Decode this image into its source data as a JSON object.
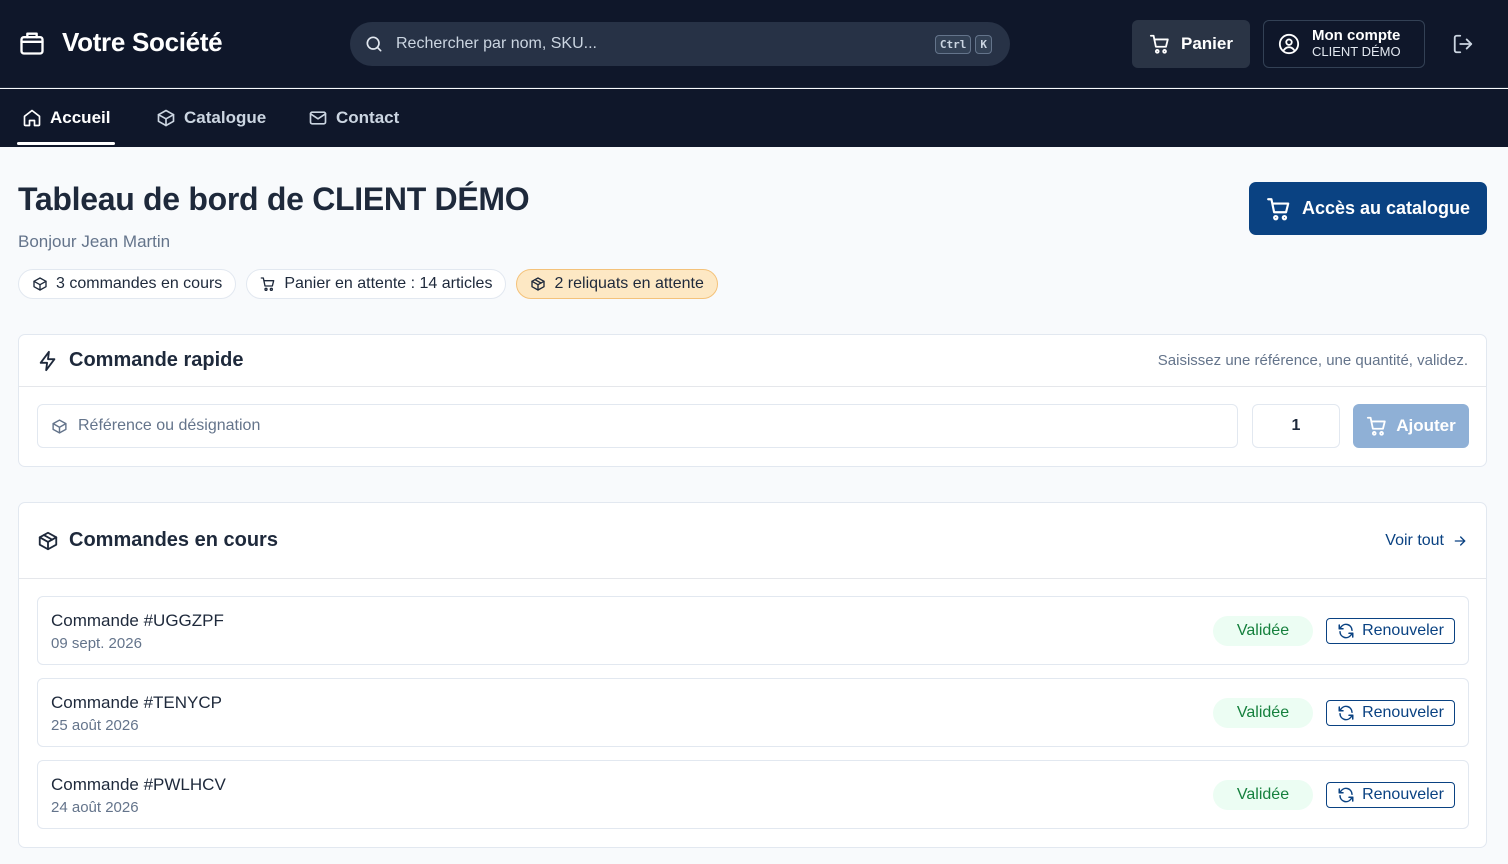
{
  "header": {
    "brand": "Votre Société",
    "search_placeholder": "Rechercher par nom, SKU...",
    "shortcut_keys": [
      "Ctrl",
      "K"
    ],
    "cart_label": "Panier",
    "account_title": "Mon compte",
    "account_subtitle": "CLIENT DÉMO"
  },
  "nav": {
    "items": [
      {
        "label": "Accueil",
        "icon": "home-icon",
        "active": true
      },
      {
        "label": "Catalogue",
        "icon": "package-icon",
        "active": false
      },
      {
        "label": "Contact",
        "icon": "mail-icon",
        "active": false
      }
    ]
  },
  "dashboard": {
    "title": "Tableau de bord de CLIENT DÉMO",
    "greeting": "Bonjour Jean Martin",
    "cta_label": "Accès au catalogue",
    "chips": [
      {
        "label": "3 commandes en cours",
        "icon": "package-icon"
      },
      {
        "label": "Panier en attente : 14 articles",
        "icon": "cart-icon"
      },
      {
        "label": "2 reliquats en attente",
        "icon": "boxes-icon"
      }
    ]
  },
  "quick_order": {
    "title": "Commande rapide",
    "hint": "Saisissez une référence, une quantité, validez.",
    "reference_placeholder": "Référence ou désignation",
    "quantity": "1",
    "add_label": "Ajouter"
  },
  "orders": {
    "title": "Commandes en cours",
    "see_all": "Voir tout",
    "renew_label": "Renouveler",
    "items": [
      {
        "name": "Commande #UGGZPF",
        "date": "09 sept. 2026",
        "status": "Validée"
      },
      {
        "name": "Commande #TENYCP",
        "date": "25 août 2026",
        "status": "Validée"
      },
      {
        "name": "Commande #PWLHCV",
        "date": "24 août 2026",
        "status": "Validée"
      }
    ]
  },
  "colors": {
    "header_bg": "#0f172a",
    "primary": "#0a4282",
    "primary_disabled": "#8fb0d6",
    "success_text": "#15803d",
    "warning_chip": "#fde8c4"
  }
}
